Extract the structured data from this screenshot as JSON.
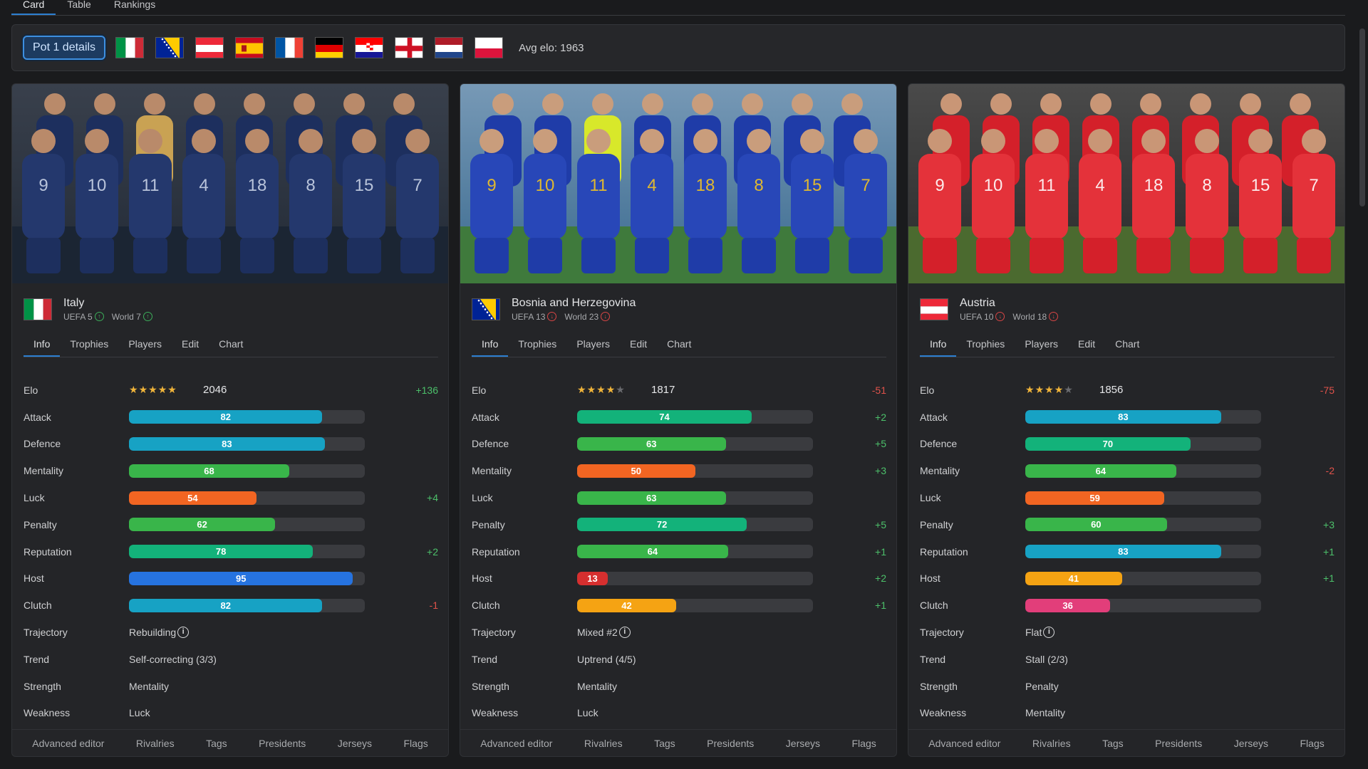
{
  "view_tabs": [
    {
      "label": "Card",
      "active": true
    },
    {
      "label": "Table",
      "active": false
    },
    {
      "label": "Rankings",
      "active": false
    }
  ],
  "pot": {
    "button_label": "Pot 1 details",
    "flags": [
      "italy",
      "bosnia",
      "austria",
      "spain",
      "france",
      "germany",
      "croatia",
      "england",
      "netherlands",
      "poland"
    ],
    "avg_elo": "Avg elo: 1963"
  },
  "card_tabs": [
    "Info",
    "Trophies",
    "Players",
    "Edit",
    "Chart"
  ],
  "footer_buttons": [
    "Advanced editor",
    "Rivalries",
    "Tags",
    "Presidents",
    "Jerseys",
    "Flags"
  ],
  "stat_labels": {
    "elo": "Elo",
    "attack": "Attack",
    "defence": "Defence",
    "mentality": "Mentality",
    "luck": "Luck",
    "penalty": "Penalty",
    "reputation": "Reputation",
    "host": "Host",
    "clutch": "Clutch",
    "trajectory": "Trajectory",
    "trend": "Trend",
    "strength": "Strength",
    "weakness": "Weakness"
  },
  "colors": {
    "teal": "#17a2c4",
    "green": "#39b54a",
    "emerald": "#13b27a",
    "orange": "#f26522",
    "blue": "#2673e0",
    "red": "#d62f2f",
    "amber": "#f5a313",
    "pink": "#e23e7a"
  },
  "teams": [
    {
      "name": "Italy",
      "flag": "italy",
      "uefa_rank": "UEFA 5",
      "uefa_trend": "up",
      "world_rank": "World 7",
      "world_trend": "up",
      "photo": "blue-kit",
      "elo": {
        "stars": 5,
        "value": "2046",
        "delta": "+136"
      },
      "stats": [
        {
          "key": "attack",
          "value": 82,
          "color": "teal",
          "delta": ""
        },
        {
          "key": "defence",
          "value": 83,
          "color": "teal",
          "delta": ""
        },
        {
          "key": "mentality",
          "value": 68,
          "color": "green",
          "delta": ""
        },
        {
          "key": "luck",
          "value": 54,
          "color": "orange",
          "delta": "+4"
        },
        {
          "key": "penalty",
          "value": 62,
          "color": "green",
          "delta": ""
        },
        {
          "key": "reputation",
          "value": 78,
          "color": "emerald",
          "delta": "+2"
        },
        {
          "key": "host",
          "value": 95,
          "color": "blue",
          "delta": ""
        },
        {
          "key": "clutch",
          "value": 82,
          "color": "teal",
          "delta": "-1"
        }
      ],
      "trajectory": "Rebuilding",
      "trend": "Self-correcting (3/3)",
      "strength": "Mentality",
      "weakness": "Luck"
    },
    {
      "name": "Bosnia and Herzegovina",
      "flag": "bosnia",
      "uefa_rank": "UEFA 13",
      "uefa_trend": "down",
      "world_rank": "World 23",
      "world_trend": "down",
      "photo": "bosnia-kit",
      "elo": {
        "stars": 4,
        "value": "1817",
        "delta": "-51"
      },
      "stats": [
        {
          "key": "attack",
          "value": 74,
          "color": "emerald",
          "delta": "+2"
        },
        {
          "key": "defence",
          "value": 63,
          "color": "green",
          "delta": "+5"
        },
        {
          "key": "mentality",
          "value": 50,
          "color": "orange",
          "delta": "+3"
        },
        {
          "key": "luck",
          "value": 63,
          "color": "green",
          "delta": ""
        },
        {
          "key": "penalty",
          "value": 72,
          "color": "emerald",
          "delta": "+5"
        },
        {
          "key": "reputation",
          "value": 64,
          "color": "green",
          "delta": "+1"
        },
        {
          "key": "host",
          "value": 13,
          "color": "red",
          "delta": "+2"
        },
        {
          "key": "clutch",
          "value": 42,
          "color": "amber",
          "delta": "+1"
        }
      ],
      "trajectory": "Mixed #2",
      "trend": "Uptrend (4/5)",
      "strength": "Mentality",
      "weakness": "Luck"
    },
    {
      "name": "Austria",
      "flag": "austria",
      "uefa_rank": "UEFA 10",
      "uefa_trend": "down",
      "world_rank": "World 18",
      "world_trend": "down",
      "photo": "red-kit",
      "elo": {
        "stars": 4,
        "value": "1856",
        "delta": "-75"
      },
      "stats": [
        {
          "key": "attack",
          "value": 83,
          "color": "teal",
          "delta": ""
        },
        {
          "key": "defence",
          "value": 70,
          "color": "emerald",
          "delta": ""
        },
        {
          "key": "mentality",
          "value": 64,
          "color": "green",
          "delta": "-2"
        },
        {
          "key": "luck",
          "value": 59,
          "color": "orange",
          "delta": ""
        },
        {
          "key": "penalty",
          "value": 60,
          "color": "green",
          "delta": "+3"
        },
        {
          "key": "reputation",
          "value": 83,
          "color": "teal",
          "delta": "+1"
        },
        {
          "key": "host",
          "value": 41,
          "color": "amber",
          "delta": "+1"
        },
        {
          "key": "clutch",
          "value": 36,
          "color": "pink",
          "delta": ""
        }
      ],
      "trajectory": "Flat",
      "trend": "Stall (2/3)",
      "strength": "Penalty",
      "weakness": "Mentality"
    }
  ]
}
